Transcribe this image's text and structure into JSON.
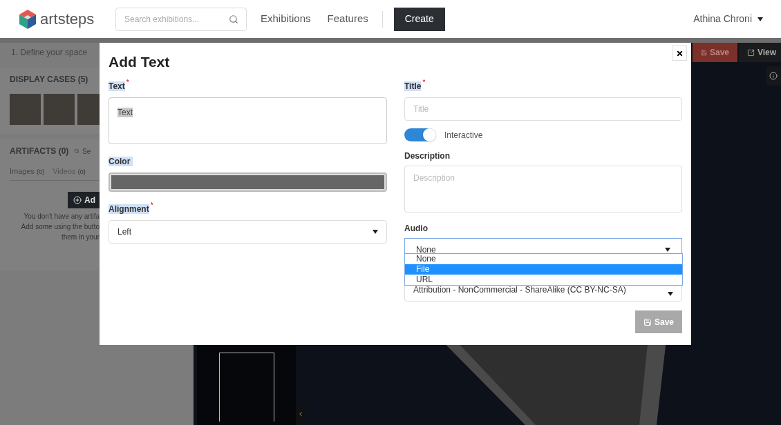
{
  "navbar": {
    "logo_text": "artsteps",
    "search": {
      "placeholder": "Search exhibitions..."
    },
    "links": [
      "Exhibitions",
      "Features"
    ],
    "create_button": "Create",
    "user": "Athina Chroni"
  },
  "editor": {
    "step": "1. Define your space",
    "save_button": "Save",
    "view_button": "View",
    "display_cases": {
      "title": "DISPLAY CASES (5)"
    },
    "artifacts": {
      "title": "ARTIFACTS (0)",
      "search_placeholder": "Se",
      "tabs": [
        {
          "label": "Images",
          "count": "(0)",
          "selected": true
        },
        {
          "label": "Videos",
          "count": "(0)",
          "selected": false
        }
      ],
      "add_button": "Ad",
      "empty_lines": [
        "You don't have any artifa",
        "Add some using the butto",
        "them in your"
      ]
    }
  },
  "modal": {
    "title": "Add Text",
    "required_mark": "*",
    "left": {
      "text_label": "Text",
      "text_value": "Text",
      "color_label": "Color",
      "color": "#666666",
      "alignment_label": "Alignment",
      "alignment_value": "Left"
    },
    "right": {
      "title_label": "Title",
      "title_placeholder": "Title",
      "interactive": {
        "label": "Interactive",
        "on": true
      },
      "description_label": "Description",
      "description_placeholder": "Description",
      "audio_label": "Audio",
      "audio_value": "None",
      "audio_options": [
        {
          "label": "None",
          "selected": false
        },
        {
          "label": "File",
          "selected": true
        },
        {
          "label": "URL",
          "selected": false
        }
      ],
      "license_value": "Attribution - NonCommercial - ShareAlike (CC BY-NC-SA)"
    },
    "save_button": "Save"
  }
}
